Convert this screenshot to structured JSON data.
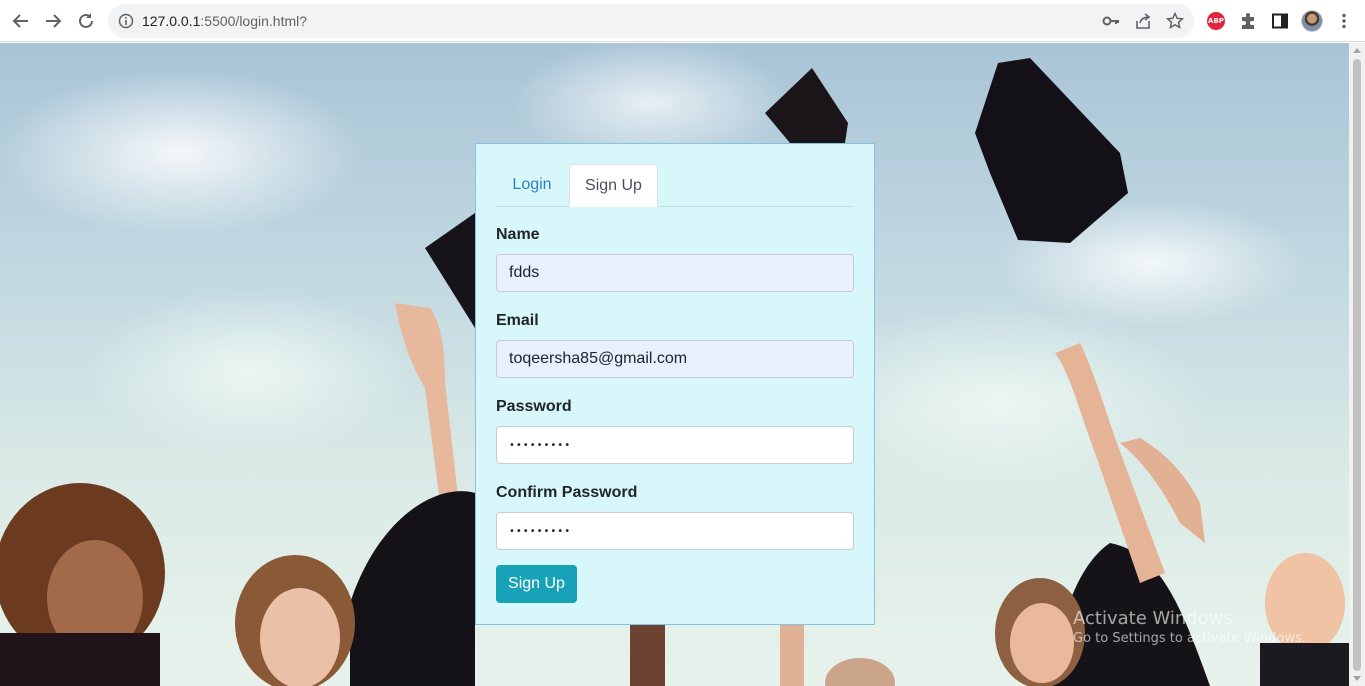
{
  "browser": {
    "url_host": "127.0.0.1",
    "url_path": ":5500/login.html?"
  },
  "tabs": [
    {
      "label": "Login",
      "active": false
    },
    {
      "label": "Sign Up",
      "active": true
    }
  ],
  "form": {
    "name_label": "Name",
    "name_value": "fdds",
    "email_label": "Email",
    "email_value": "toqeersha85@gmail.com",
    "password_label": "Password",
    "password_value": "•••••••••",
    "confirm_label": "Confirm Password",
    "confirm_value": "•••••••••",
    "submit_label": "Sign Up"
  },
  "watermark": {
    "title": "Activate Windows",
    "subtitle": "Go to Settings to activate Windows."
  },
  "colors": {
    "card_bg": "#d7f7fb",
    "submit_bg": "#17a2b8",
    "tab_link": "#2e7fc2"
  }
}
